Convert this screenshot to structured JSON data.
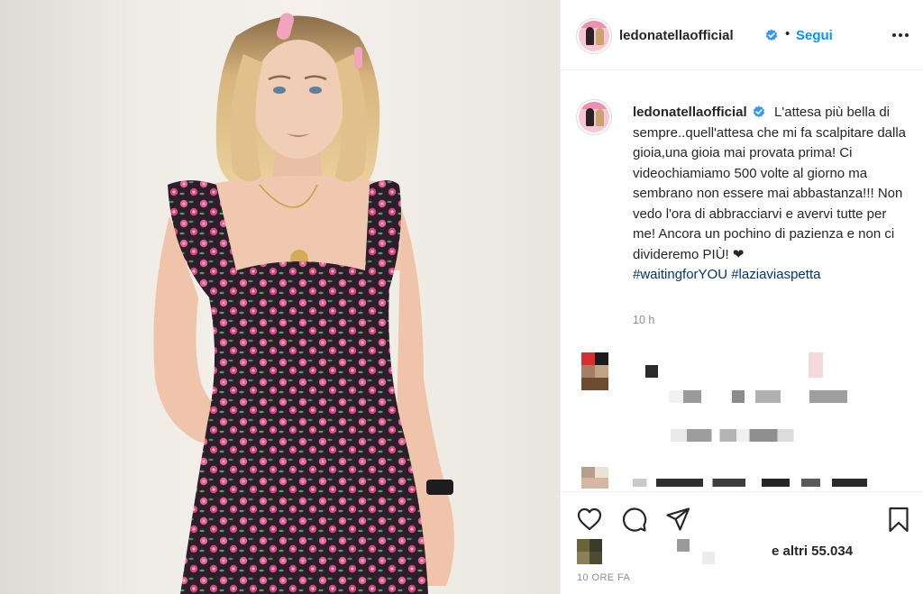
{
  "post": {
    "username": "ledonatella",
    "account": "ledonatellaofficial",
    "follow_label": "Segui",
    "separator": "•",
    "caption_text": "L'attesa più bella di sempre..quell'attesa che mi fa scalpitare dalla gioia,una gioia mai provata prima! Ci videochiamiamo 500 volte al giorno ma sembrano non essere mai abbastanza!!! Non vedo l'ora di abbracciarvi e avervi tutte per me! Ancora un pochino di pazienza e non ci divideremo PIÙ! ❤",
    "hashtags": [
      "#waitingforYOU",
      "#laziaviaspetta"
    ],
    "time_ago": "10 h",
    "likes_text": "e altri 55.034",
    "date_label": "10 ORE FA"
  },
  "icons": {
    "verified": "verified-badge-icon",
    "more": "more-options-icon",
    "like": "heart-icon",
    "comment": "comment-icon",
    "share": "share-icon",
    "save": "bookmark-icon"
  },
  "colors": {
    "accent": "#0095f6",
    "verified": "#3897f0",
    "hashtag": "#00376b",
    "muted": "#8e8e8e",
    "dress_base": "#2a1f2a",
    "dress_flower": "#e45d8f"
  }
}
